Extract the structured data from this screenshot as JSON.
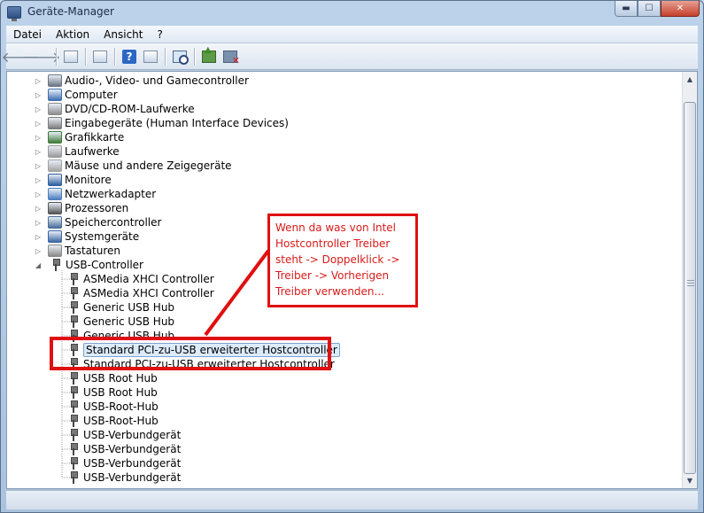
{
  "window": {
    "title": "Geräte-Manager",
    "controls": {
      "minimize": "▬",
      "maximize": "☐",
      "close": "✕"
    }
  },
  "menu": {
    "items": [
      {
        "label": "Datei"
      },
      {
        "label": "Aktion"
      },
      {
        "label": "Ansicht"
      },
      {
        "label": "?"
      }
    ]
  },
  "toolbar": {
    "back": "🡐",
    "forward": "🡒"
  },
  "tree": {
    "categories": [
      {
        "label": "Audio-, Video- und Gamecontroller",
        "icon": "speaker-icon"
      },
      {
        "label": "Computer",
        "icon": "computer-icon"
      },
      {
        "label": "DVD/CD-ROM-Laufwerke",
        "icon": "disc-drive-icon"
      },
      {
        "label": "Eingabegeräte (Human Interface Devices)",
        "icon": "hid-icon"
      },
      {
        "label": "Grafikkarte",
        "icon": "display-adapter-icon"
      },
      {
        "label": "Laufwerke",
        "icon": "disk-drive-icon"
      },
      {
        "label": "Mäuse und andere Zeigegeräte",
        "icon": "mouse-icon"
      },
      {
        "label": "Monitore",
        "icon": "monitor-icon"
      },
      {
        "label": "Netzwerkadapter",
        "icon": "network-adapter-icon"
      },
      {
        "label": "Prozessoren",
        "icon": "processor-icon"
      },
      {
        "label": "Speichercontroller",
        "icon": "storage-controller-icon"
      },
      {
        "label": "Systemgeräte",
        "icon": "system-device-icon"
      },
      {
        "label": "Tastaturen",
        "icon": "keyboard-icon"
      },
      {
        "label": "USB-Controller",
        "icon": "usb-icon",
        "expanded": true
      }
    ],
    "usb_children": [
      {
        "label": "ASMedia XHCI Controller"
      },
      {
        "label": "ASMedia XHCI Controller"
      },
      {
        "label": "Generic USB Hub"
      },
      {
        "label": "Generic USB Hub"
      },
      {
        "label": "Generic USB Hub"
      },
      {
        "label": "Standard PCI-zu-USB erweiterter Hostcontroller",
        "selected": true
      },
      {
        "label": "Standard PCI-zu-USB erweiterter Hostcontroller"
      },
      {
        "label": "USB Root Hub"
      },
      {
        "label": "USB Root Hub"
      },
      {
        "label": "USB-Root-Hub"
      },
      {
        "label": "USB-Root-Hub"
      },
      {
        "label": "USB-Verbundgerät"
      },
      {
        "label": "USB-Verbundgerät"
      },
      {
        "label": "USB-Verbundgerät"
      },
      {
        "label": "USB-Verbundgerät"
      }
    ]
  },
  "annotation": {
    "text": "Wenn da was von Intel Hostcontroller Treiber steht -> Doppelklick -> Treiber -> Vorherigen Treiber verwenden...",
    "color": "#e01010"
  }
}
